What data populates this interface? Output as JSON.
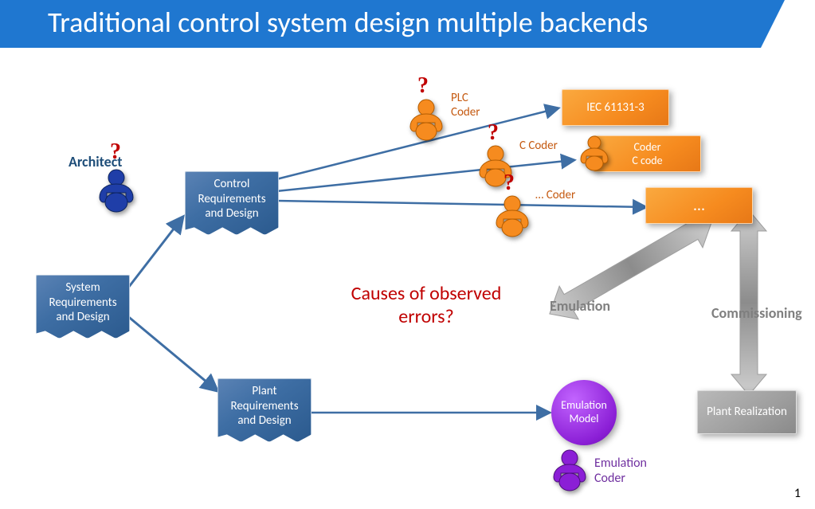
{
  "title": {
    "part1": "Traditional control system design ",
    "part2": "multiple backends"
  },
  "boxes": {
    "system_req": "System Requirements and Design",
    "control_req": "Control Requirements and Design",
    "plant_req": "Plant Requirements and Design",
    "iec": "IEC 61131-3",
    "coder_top": "Coder",
    "c_code": "C code",
    "ellipsis": "…",
    "plant_real": "Plant Realization"
  },
  "circle": {
    "emulation_model": "Emulation Model"
  },
  "labels": {
    "architect": "Architect",
    "plc_coder": "PLC Coder",
    "c_coder": "C Coder",
    "other_coder": "… Coder",
    "causes": "Causes of observed errors?",
    "emulation": "Emulation",
    "commissioning": "Commissioning",
    "emulation_coder": "Emulation Coder"
  },
  "page_number": "1"
}
